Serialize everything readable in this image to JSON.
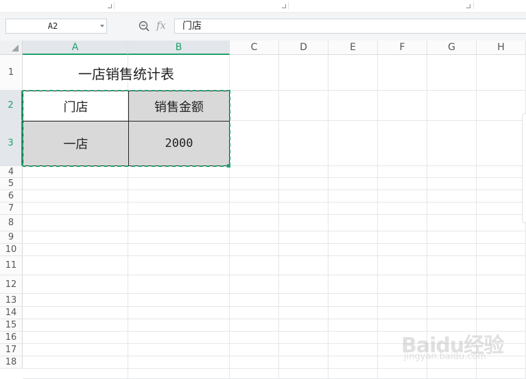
{
  "formula_bar": {
    "name_box": "A2",
    "fx_label": "fx",
    "formula": "门店"
  },
  "columns": [
    "A",
    "B",
    "C",
    "D",
    "E",
    "F",
    "G",
    "H"
  ],
  "rows": [
    "1",
    "2",
    "3",
    "4",
    "5",
    "6",
    "7",
    "8",
    "9",
    "10",
    "11",
    "12",
    "13",
    "14",
    "15",
    "16",
    "17",
    "18"
  ],
  "sheet": {
    "title": "一店销售统计表",
    "header": {
      "store": "门店",
      "amount": "销售金额"
    },
    "data_row": {
      "store": "一店",
      "amount": "2000"
    }
  },
  "selection": {
    "range": "A2:B3",
    "accent_color": "#1fa16b"
  },
  "watermark": {
    "main": "Baidu经验",
    "sub": "jingyan.baidu.com"
  }
}
